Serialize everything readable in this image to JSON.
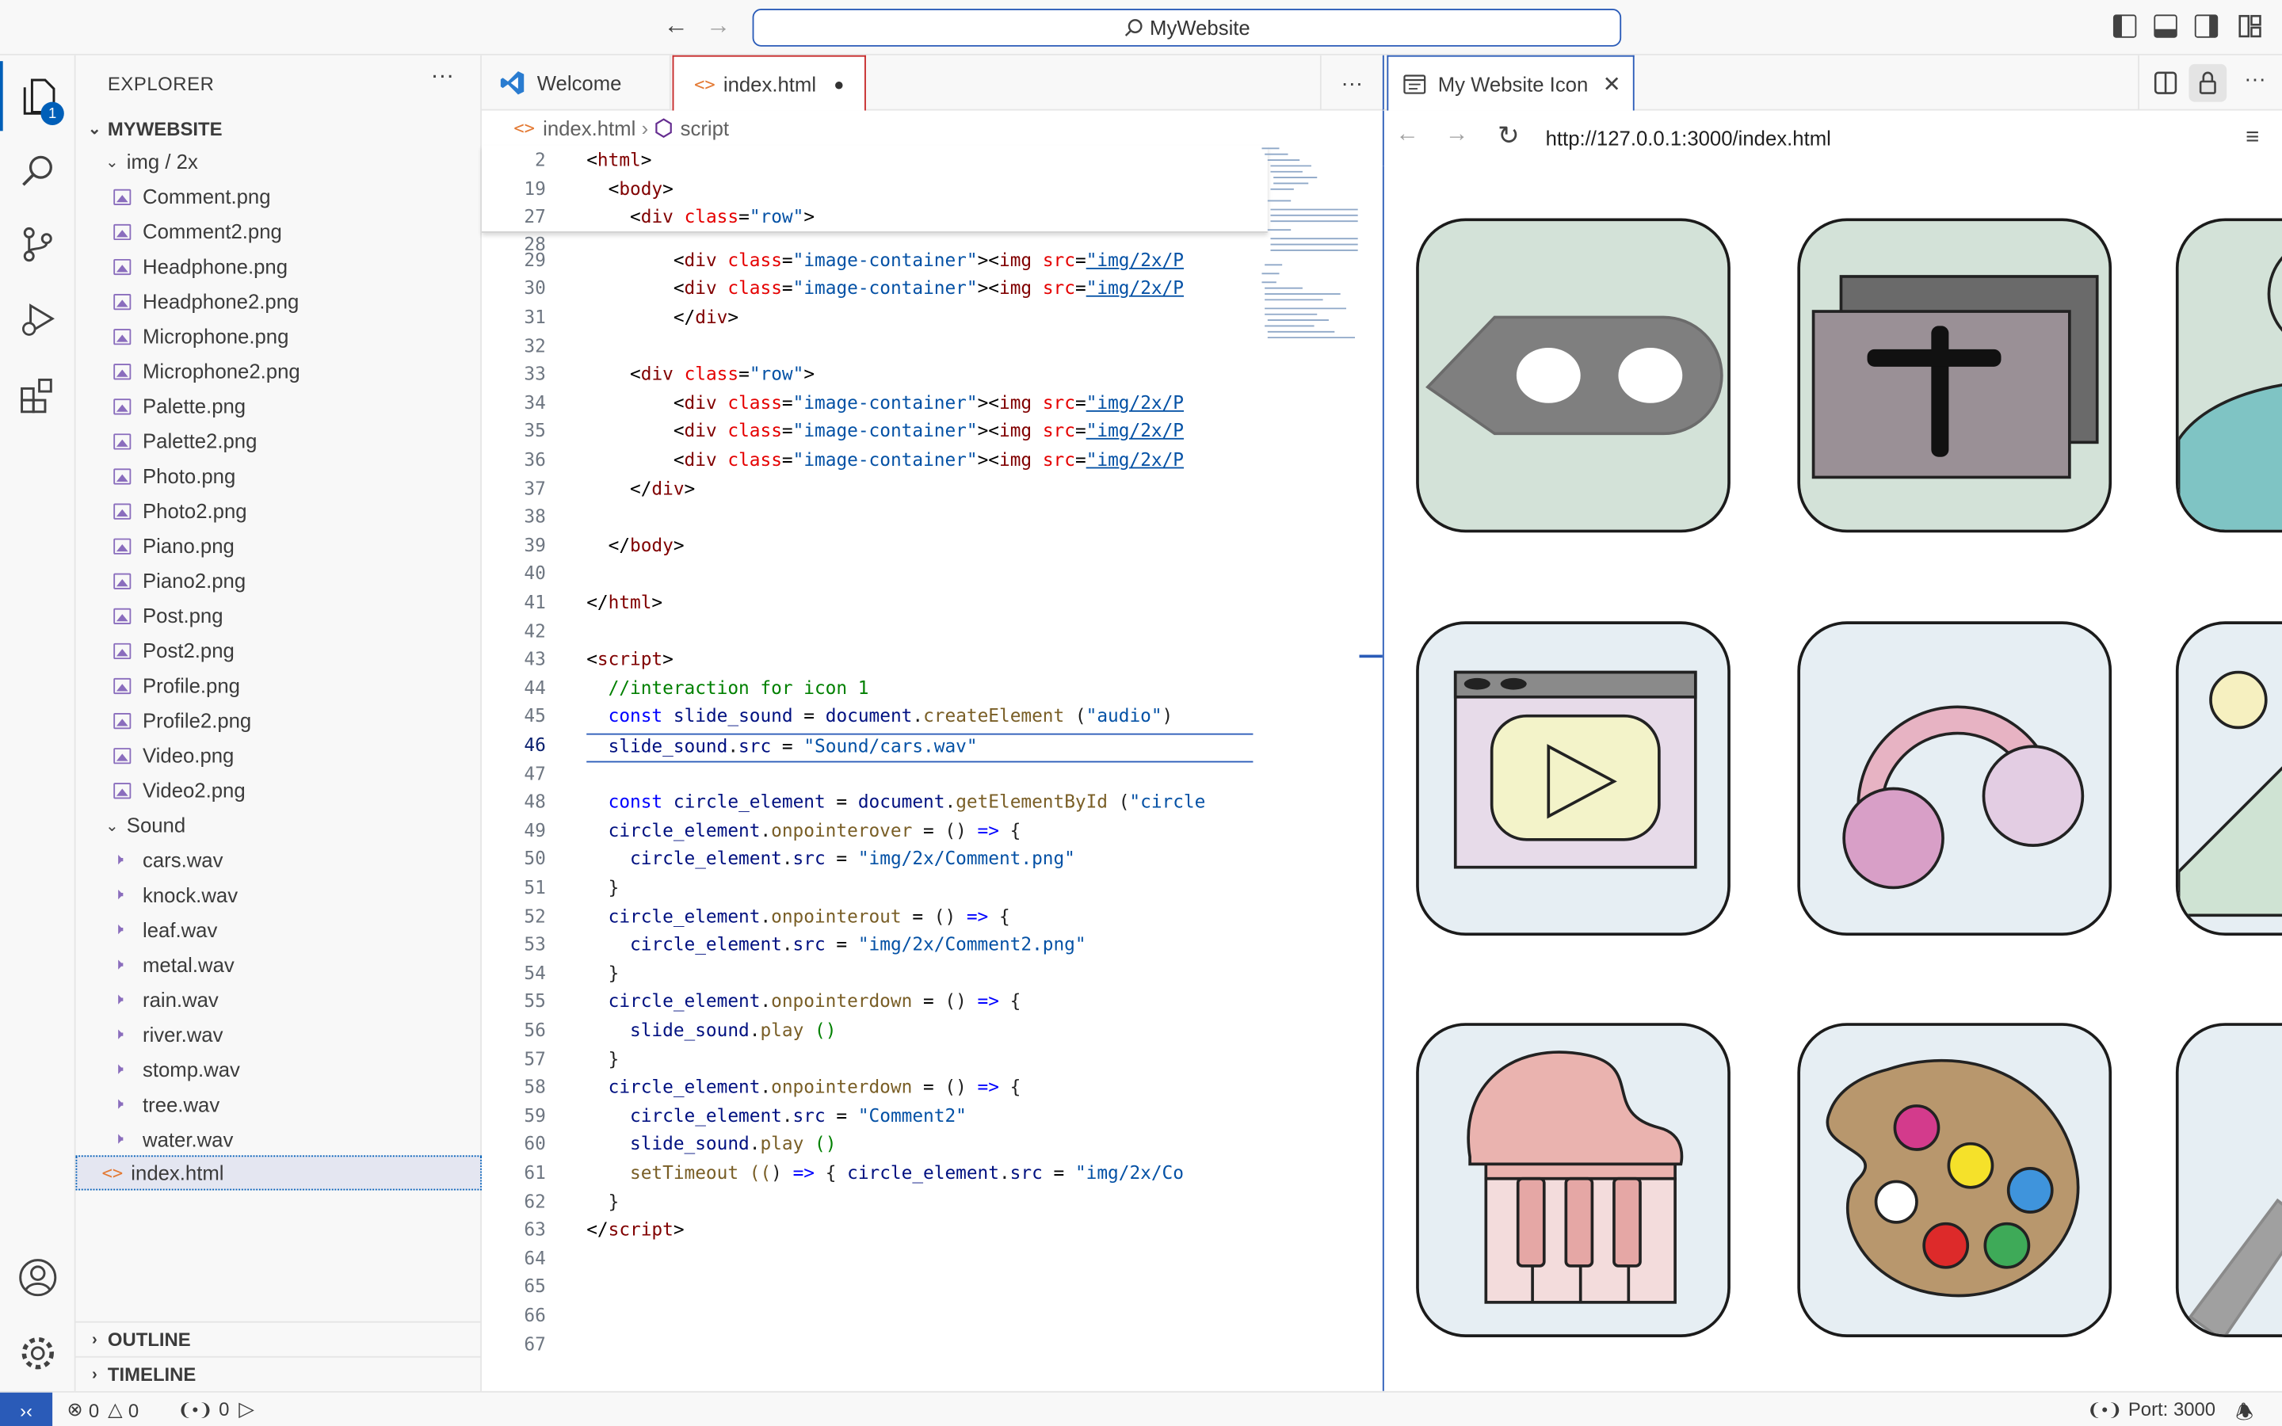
{
  "titlebar": {
    "search": "MyWebsite"
  },
  "activity": {
    "explorer_badge": "1"
  },
  "explorer": {
    "title": "EXPLORER",
    "root": "MYWEBSITE",
    "img_folder": "img / 2x",
    "images": [
      "Comment.png",
      "Comment2.png",
      "Headphone.png",
      "Headphone2.png",
      "Microphone.png",
      "Microphone2.png",
      "Palette.png",
      "Palette2.png",
      "Photo.png",
      "Photo2.png",
      "Piano.png",
      "Piano2.png",
      "Post.png",
      "Post2.png",
      "Profile.png",
      "Profile2.png",
      "Video.png",
      "Video2.png"
    ],
    "sound_folder": "Sound",
    "sounds": [
      "cars.wav",
      "knock.wav",
      "leaf.wav",
      "metal.wav",
      "rain.wav",
      "river.wav",
      "stomp.wav",
      "tree.wav",
      "water.wav"
    ],
    "file": "index.html",
    "outline": "OUTLINE",
    "timeline": "TIMELINE"
  },
  "editor": {
    "tabs": [
      {
        "label": "Welcome"
      },
      {
        "label": "index.html"
      }
    ],
    "breadcrumb": {
      "file": "index.html",
      "symbol": "script"
    },
    "current_line": "46"
  },
  "browser": {
    "tab_title": "My Website Icon",
    "url": "http://127.0.0.1:3000/index.html"
  },
  "status": {
    "errors": "0",
    "warnings": "0",
    "ports_count": "0",
    "port": "Port: 3000"
  },
  "colors": {
    "accent": "#2a5bb8",
    "icon_bg_green": "#d3e2d8",
    "icon_bg_blue": "#e6eef3"
  }
}
